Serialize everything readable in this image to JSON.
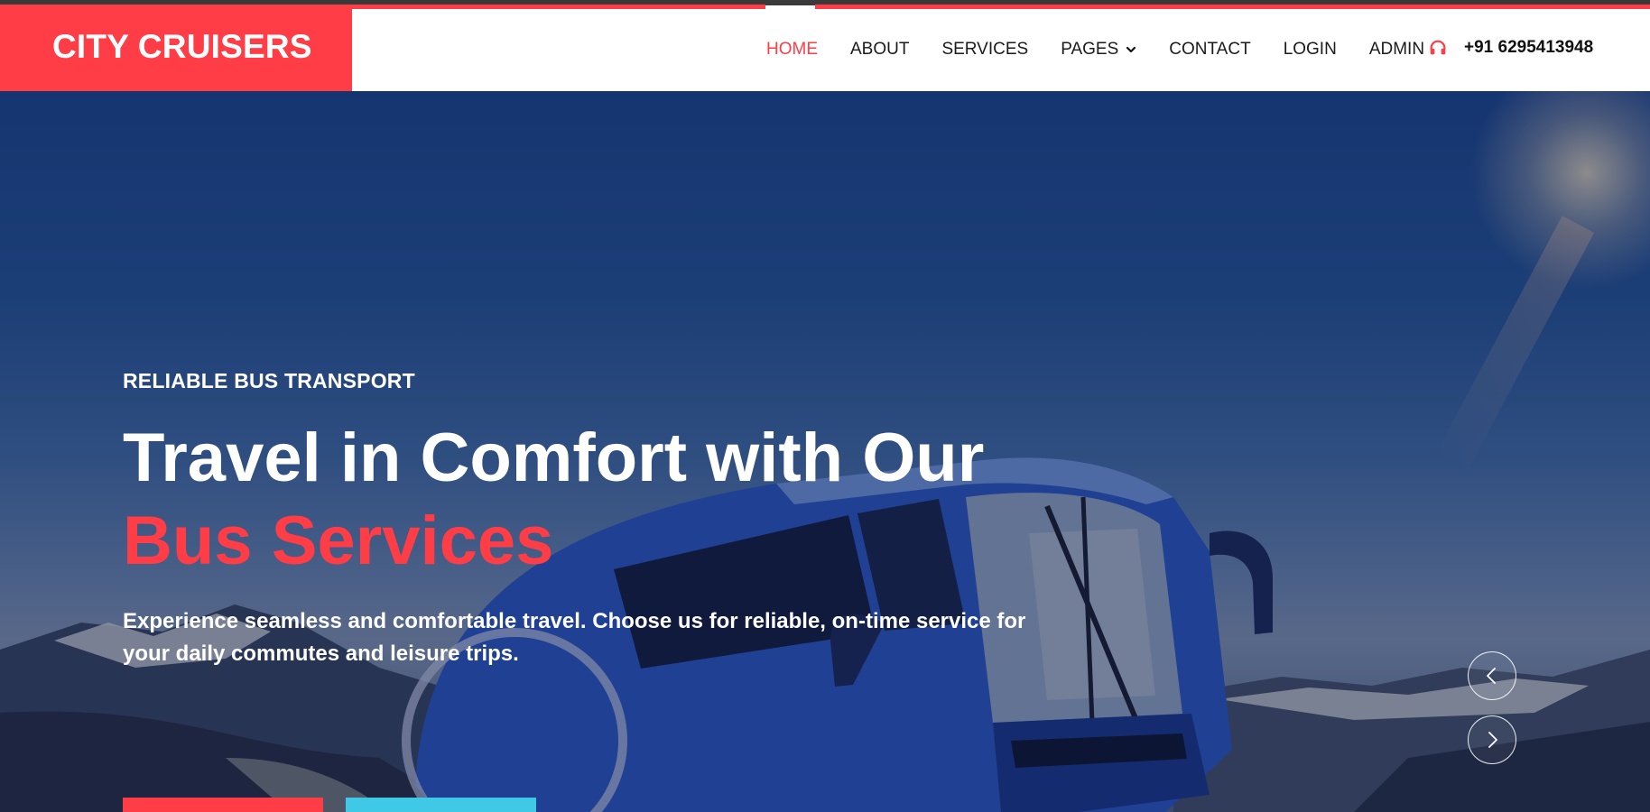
{
  "brand": {
    "name": "CITY CRUISERS"
  },
  "nav": {
    "items": [
      {
        "label": "HOME",
        "active": true
      },
      {
        "label": "ABOUT",
        "active": false
      },
      {
        "label": "SERVICES",
        "active": false
      },
      {
        "label": "PAGES",
        "active": false,
        "dropdown": true
      },
      {
        "label": "CONTACT",
        "active": false
      },
      {
        "label": "LOGIN",
        "active": false
      },
      {
        "label": "ADMIN",
        "active": false
      }
    ]
  },
  "contact": {
    "phone": "+91 6295413948",
    "icon": "headset-icon"
  },
  "hero": {
    "eyebrow": "RELIABLE BUS TRANSPORT",
    "headline": "Travel in Comfort with Our",
    "headline_accent": "Bus Services",
    "lede": "Experience seamless and comfortable travel. Choose us for reliable, on-time service for your daily commutes and leisure trips.",
    "arrows": {
      "prev": "chevron-left-icon",
      "next": "chevron-right-icon"
    }
  },
  "colors": {
    "accent": "#ff3d46",
    "secondary": "#3fc9e6",
    "nav_text": "#1b1b1b",
    "hero_text": "#ffffff"
  }
}
